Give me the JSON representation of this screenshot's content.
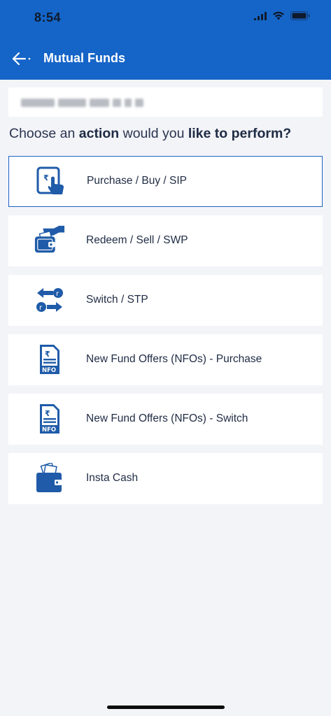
{
  "status_bar": {
    "time": "8:54"
  },
  "header": {
    "title": "Mutual Funds"
  },
  "prompt": {
    "part1": "Choose an ",
    "bold1": "action",
    "part2": " would you ",
    "bold2": "like to perform?"
  },
  "actions": [
    {
      "label": "Purchase / Buy / SIP",
      "icon": "purchase-icon"
    },
    {
      "label": "Redeem / Sell / SWP",
      "icon": "redeem-icon"
    },
    {
      "label": "Switch / STP",
      "icon": "switch-icon"
    },
    {
      "label": "New Fund Offers (NFOs) - Purchase",
      "icon": "nfo-icon"
    },
    {
      "label": "New Fund Offers (NFOs) - Switch",
      "icon": "nfo-icon"
    },
    {
      "label": "Insta Cash",
      "icon": "wallet-icon"
    }
  ],
  "colors": {
    "primary": "#1565c8",
    "background": "#f3f4f8",
    "text": "#1f2b44"
  }
}
